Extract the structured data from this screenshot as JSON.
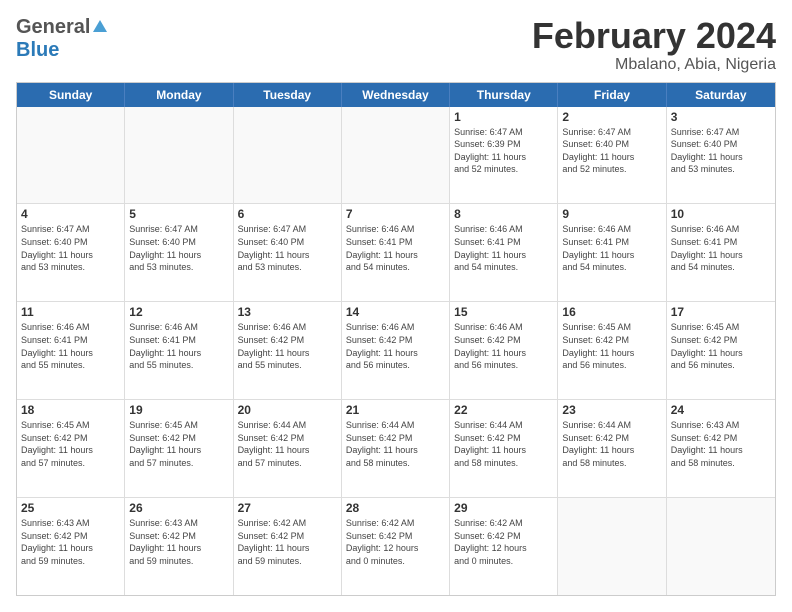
{
  "header": {
    "logo_general": "General",
    "logo_blue": "Blue",
    "title": "February 2024",
    "subtitle": "Mbalano, Abia, Nigeria"
  },
  "weekdays": [
    "Sunday",
    "Monday",
    "Tuesday",
    "Wednesday",
    "Thursday",
    "Friday",
    "Saturday"
  ],
  "weeks": [
    [
      {
        "date": "",
        "info": ""
      },
      {
        "date": "",
        "info": ""
      },
      {
        "date": "",
        "info": ""
      },
      {
        "date": "",
        "info": ""
      },
      {
        "date": "1",
        "info": "Sunrise: 6:47 AM\nSunset: 6:39 PM\nDaylight: 11 hours\nand 52 minutes."
      },
      {
        "date": "2",
        "info": "Sunrise: 6:47 AM\nSunset: 6:40 PM\nDaylight: 11 hours\nand 52 minutes."
      },
      {
        "date": "3",
        "info": "Sunrise: 6:47 AM\nSunset: 6:40 PM\nDaylight: 11 hours\nand 53 minutes."
      }
    ],
    [
      {
        "date": "4",
        "info": "Sunrise: 6:47 AM\nSunset: 6:40 PM\nDaylight: 11 hours\nand 53 minutes."
      },
      {
        "date": "5",
        "info": "Sunrise: 6:47 AM\nSunset: 6:40 PM\nDaylight: 11 hours\nand 53 minutes."
      },
      {
        "date": "6",
        "info": "Sunrise: 6:47 AM\nSunset: 6:40 PM\nDaylight: 11 hours\nand 53 minutes."
      },
      {
        "date": "7",
        "info": "Sunrise: 6:46 AM\nSunset: 6:41 PM\nDaylight: 11 hours\nand 54 minutes."
      },
      {
        "date": "8",
        "info": "Sunrise: 6:46 AM\nSunset: 6:41 PM\nDaylight: 11 hours\nand 54 minutes."
      },
      {
        "date": "9",
        "info": "Sunrise: 6:46 AM\nSunset: 6:41 PM\nDaylight: 11 hours\nand 54 minutes."
      },
      {
        "date": "10",
        "info": "Sunrise: 6:46 AM\nSunset: 6:41 PM\nDaylight: 11 hours\nand 54 minutes."
      }
    ],
    [
      {
        "date": "11",
        "info": "Sunrise: 6:46 AM\nSunset: 6:41 PM\nDaylight: 11 hours\nand 55 minutes."
      },
      {
        "date": "12",
        "info": "Sunrise: 6:46 AM\nSunset: 6:41 PM\nDaylight: 11 hours\nand 55 minutes."
      },
      {
        "date": "13",
        "info": "Sunrise: 6:46 AM\nSunset: 6:42 PM\nDaylight: 11 hours\nand 55 minutes."
      },
      {
        "date": "14",
        "info": "Sunrise: 6:46 AM\nSunset: 6:42 PM\nDaylight: 11 hours\nand 56 minutes."
      },
      {
        "date": "15",
        "info": "Sunrise: 6:46 AM\nSunset: 6:42 PM\nDaylight: 11 hours\nand 56 minutes."
      },
      {
        "date": "16",
        "info": "Sunrise: 6:45 AM\nSunset: 6:42 PM\nDaylight: 11 hours\nand 56 minutes."
      },
      {
        "date": "17",
        "info": "Sunrise: 6:45 AM\nSunset: 6:42 PM\nDaylight: 11 hours\nand 56 minutes."
      }
    ],
    [
      {
        "date": "18",
        "info": "Sunrise: 6:45 AM\nSunset: 6:42 PM\nDaylight: 11 hours\nand 57 minutes."
      },
      {
        "date": "19",
        "info": "Sunrise: 6:45 AM\nSunset: 6:42 PM\nDaylight: 11 hours\nand 57 minutes."
      },
      {
        "date": "20",
        "info": "Sunrise: 6:44 AM\nSunset: 6:42 PM\nDaylight: 11 hours\nand 57 minutes."
      },
      {
        "date": "21",
        "info": "Sunrise: 6:44 AM\nSunset: 6:42 PM\nDaylight: 11 hours\nand 58 minutes."
      },
      {
        "date": "22",
        "info": "Sunrise: 6:44 AM\nSunset: 6:42 PM\nDaylight: 11 hours\nand 58 minutes."
      },
      {
        "date": "23",
        "info": "Sunrise: 6:44 AM\nSunset: 6:42 PM\nDaylight: 11 hours\nand 58 minutes."
      },
      {
        "date": "24",
        "info": "Sunrise: 6:43 AM\nSunset: 6:42 PM\nDaylight: 11 hours\nand 58 minutes."
      }
    ],
    [
      {
        "date": "25",
        "info": "Sunrise: 6:43 AM\nSunset: 6:42 PM\nDaylight: 11 hours\nand 59 minutes."
      },
      {
        "date": "26",
        "info": "Sunrise: 6:43 AM\nSunset: 6:42 PM\nDaylight: 11 hours\nand 59 minutes."
      },
      {
        "date": "27",
        "info": "Sunrise: 6:42 AM\nSunset: 6:42 PM\nDaylight: 11 hours\nand 59 minutes."
      },
      {
        "date": "28",
        "info": "Sunrise: 6:42 AM\nSunset: 6:42 PM\nDaylight: 12 hours\nand 0 minutes."
      },
      {
        "date": "29",
        "info": "Sunrise: 6:42 AM\nSunset: 6:42 PM\nDaylight: 12 hours\nand 0 minutes."
      },
      {
        "date": "",
        "info": ""
      },
      {
        "date": "",
        "info": ""
      }
    ]
  ]
}
